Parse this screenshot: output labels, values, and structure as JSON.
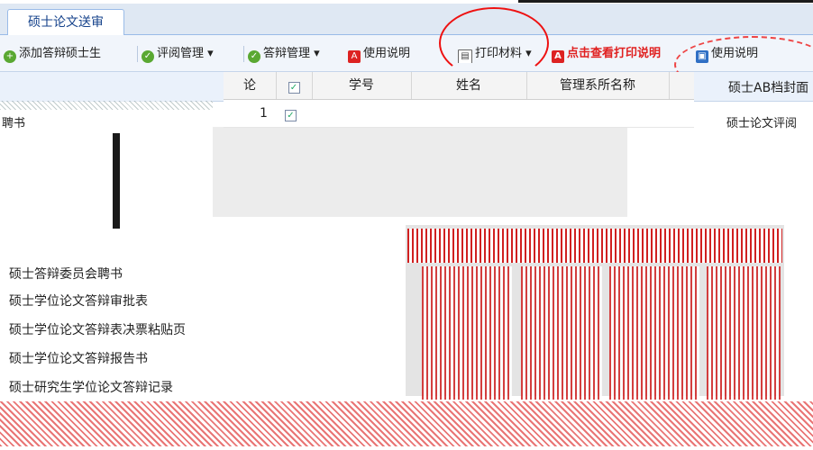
{
  "tab": {
    "label": "硕士论文送审"
  },
  "toolbar": {
    "add_student": "添加答辩硕士生",
    "review_manage": "评阅管理",
    "defense_manage": "答辩管理",
    "usage_note": "使用说明",
    "print_materials": "打印材料",
    "print_note": "点击查看打印说明",
    "extra": "使用说明"
  },
  "left_panel": {
    "header": "聘书",
    "items": [
      "硕士答辩委员会聘书",
      "硕士学位论文答辩审批表",
      "硕士学位论文答辩表决票粘贴页",
      "硕士学位论文答辩报告书",
      "硕士研究生学位论文答辩记录"
    ]
  },
  "grid": {
    "columns": [
      "论",
      "",
      "学号",
      "姓名",
      "管理系所名称"
    ],
    "rows": [
      {
        "index": "1"
      }
    ]
  },
  "right_panel": {
    "header": "硕士AB档封面",
    "sub": "硕士论文评阅"
  },
  "colors": {
    "accent": "#15428b",
    "annotation": "#e02020"
  }
}
